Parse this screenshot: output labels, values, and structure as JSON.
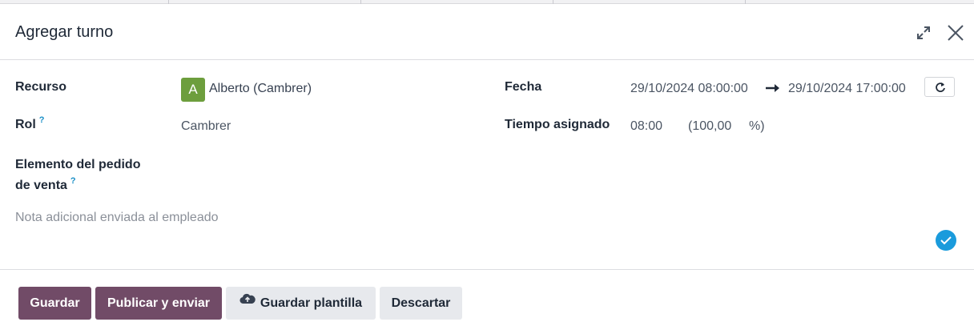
{
  "dialog": {
    "title": "Agregar turno",
    "icons": {
      "expand": "expand-icon",
      "close": "close-icon"
    }
  },
  "form": {
    "resource_label": "Recurso",
    "resource_avatar_letter": "A",
    "resource_value": "Alberto (Cambrer)",
    "role_label": "Rol",
    "role_help": "?",
    "role_value": "Cambrer",
    "sale_line_label_1": "Elemento del pedido",
    "sale_line_label_2": "de venta",
    "sale_line_help": "?",
    "date_label": "Fecha",
    "date_start": "29/10/2024 08:00:00",
    "date_end": "29/10/2024 17:00:00",
    "allocated_label": "Tiempo asignado",
    "allocated_hours": "08:00",
    "allocated_percent_open": "(100,00",
    "allocated_percent_close": "%)",
    "note_placeholder": "Nota adicional enviada al empleado"
  },
  "footer": {
    "save_label": "Guardar",
    "publish_label": "Publicar y enviar",
    "template_label": "Guardar plantilla",
    "discard_label": "Descartar"
  },
  "colors": {
    "primary": "#714b67",
    "avatar": "#6d9e3d",
    "help": "#1a8fc7",
    "check": "#1a9bdc"
  }
}
